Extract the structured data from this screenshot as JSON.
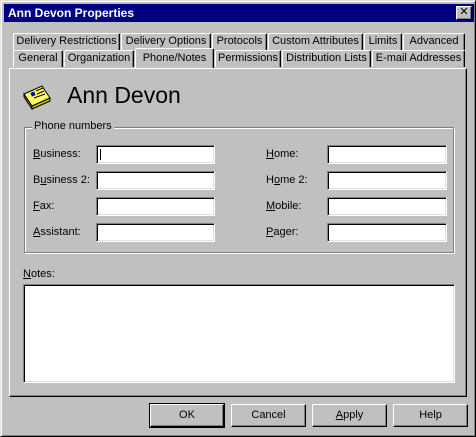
{
  "window": {
    "title": "Ann Devon Properties",
    "close_glyph": "✕"
  },
  "tabs_back_row": [
    "Delivery Restrictions",
    "Delivery Options",
    "Protocols",
    "Custom Attributes",
    "Limits",
    "Advanced"
  ],
  "tabs_front_row": [
    "General",
    "Organization",
    "Phone/Notes",
    "Permissions",
    "Distribution Lists",
    "E-mail Addresses"
  ],
  "active_tab": "Phone/Notes",
  "header": {
    "name": "Ann Devon",
    "icon": "user-card-icon"
  },
  "phone_group": {
    "label": "Phone numbers",
    "fields": {
      "business": {
        "mnemonic": "B",
        "rest": "usiness:",
        "value": ""
      },
      "business2": {
        "mnemonic": "u",
        "pre": "B",
        "rest": "siness 2:",
        "value": ""
      },
      "fax": {
        "mnemonic": "F",
        "rest": "ax:",
        "value": ""
      },
      "assistant": {
        "mnemonic": "A",
        "rest": "ssistant:",
        "value": ""
      },
      "home": {
        "mnemonic": "H",
        "rest": "ome:",
        "value": ""
      },
      "home2": {
        "mnemonic": "o",
        "pre": "H",
        "rest": "me 2:",
        "value": ""
      },
      "mobile": {
        "mnemonic": "M",
        "rest": "obile:",
        "value": ""
      },
      "pager": {
        "mnemonic": "P",
        "rest": "ager:",
        "value": ""
      }
    }
  },
  "notes": {
    "mnemonic": "N",
    "rest": "otes:",
    "value": ""
  },
  "buttons": {
    "ok": "OK",
    "cancel": "Cancel",
    "apply_mnemonic": "A",
    "apply_rest": "pply",
    "help": "Help"
  },
  "colors": {
    "titlebar": "#000080",
    "face": "#c0c0c0",
    "icon_yellow": "#ffff66"
  }
}
